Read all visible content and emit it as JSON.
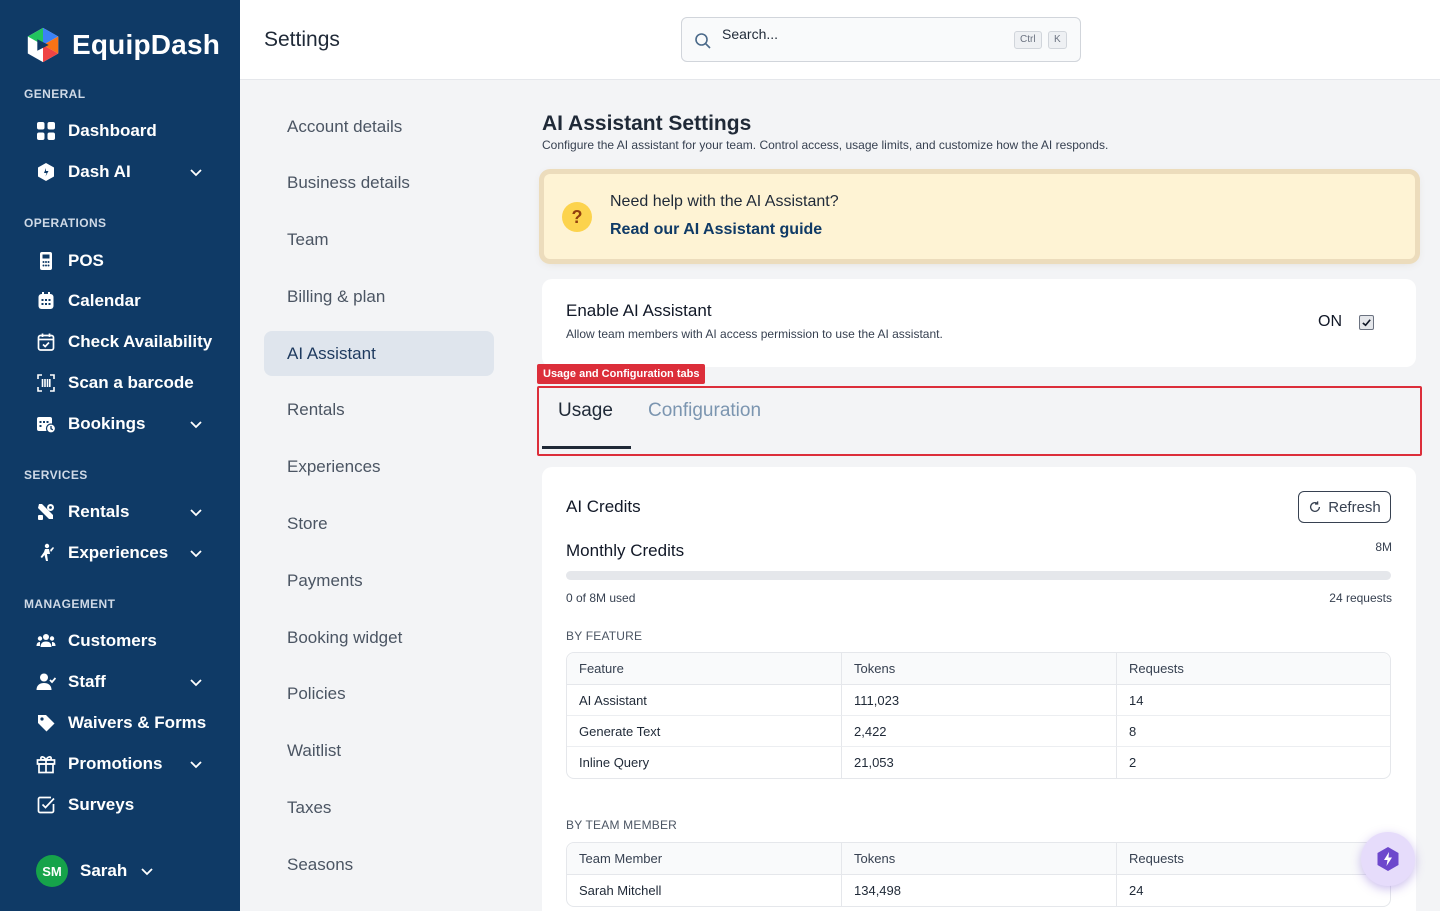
{
  "app": {
    "name": "EquipDash",
    "colors": {
      "sidebar": "#0f3a66",
      "accent": "#0f3a66",
      "annotation": "#dc2e3a",
      "help_bg": "#fef3d4"
    }
  },
  "sidebar": {
    "sections": {
      "general": "GENERAL",
      "operations": "OPERATIONS",
      "services": "SERVICES",
      "management": "MANAGEMENT"
    },
    "items": [
      {
        "label": "Dashboard",
        "icon": "grid-icon"
      },
      {
        "label": "Dash AI",
        "icon": "hexagon-icon",
        "expandable": true
      },
      {
        "label": "POS",
        "icon": "pos-terminal-icon"
      },
      {
        "label": "Calendar",
        "icon": "calendar-icon"
      },
      {
        "label": "Check Availability",
        "icon": "calendar-check-icon"
      },
      {
        "label": "Scan a barcode",
        "icon": "barcode-scan-icon"
      },
      {
        "label": "Bookings",
        "icon": "bookings-icon",
        "expandable": true
      },
      {
        "label": "Rentals",
        "icon": "tools-icon",
        "expandable": true
      },
      {
        "label": "Experiences",
        "icon": "climber-icon",
        "expandable": true
      },
      {
        "label": "Customers",
        "icon": "users-icon"
      },
      {
        "label": "Staff",
        "icon": "staff-icon",
        "expandable": true
      },
      {
        "label": "Waivers & Forms",
        "icon": "tag-icon"
      },
      {
        "label": "Promotions",
        "icon": "gift-icon",
        "expandable": true
      },
      {
        "label": "Surveys",
        "icon": "checkbox-square-icon"
      }
    ],
    "user": {
      "initials": "SM",
      "name": "Sarah"
    }
  },
  "header": {
    "title": "Settings",
    "search": {
      "placeholder": "Search...",
      "kbd_ctrl": "Ctrl",
      "kbd_key": "K"
    }
  },
  "settings_nav": {
    "items": [
      "Account details",
      "Business details",
      "Team",
      "Billing & plan",
      "AI Assistant",
      "Rentals",
      "Experiences",
      "Store",
      "Payments",
      "Booking widget",
      "Policies",
      "Waitlist",
      "Taxes",
      "Seasons"
    ],
    "active": "AI Assistant"
  },
  "page": {
    "title": "AI Assistant Settings",
    "subtitle": "Configure the AI assistant for your team. Control access, usage limits, and customize how the AI responds.",
    "help": {
      "question": "Need help with the AI Assistant?",
      "link": "Read our AI Assistant guide"
    },
    "enable": {
      "title": "Enable AI Assistant",
      "subtitle": "Allow team members with AI access permission to use the AI assistant.",
      "state": "ON",
      "checked": true
    },
    "annotation": "Usage and Configuration tabs",
    "tabs": [
      {
        "label": "Usage",
        "active": true
      },
      {
        "label": "Configuration",
        "active": false
      }
    ],
    "credits": {
      "title": "AI Credits",
      "refresh": "Refresh",
      "monthly_label": "Monthly Credits",
      "limit": "8M",
      "used_text": "0 of 8M used",
      "used_fraction": 0,
      "requests_text": "24 requests"
    },
    "by_feature": {
      "label": "BY FEATURE",
      "columns": [
        "Feature",
        "Tokens",
        "Requests"
      ],
      "rows": [
        [
          "AI Assistant",
          "111,023",
          "14"
        ],
        [
          "Generate Text",
          "2,422",
          "8"
        ],
        [
          "Inline Query",
          "21,053",
          "2"
        ]
      ]
    },
    "by_team_member": {
      "label": "BY TEAM MEMBER",
      "columns": [
        "Team Member",
        "Tokens",
        "Requests"
      ],
      "rows": [
        [
          "Sarah Mitchell",
          "134,498",
          "24"
        ]
      ]
    }
  }
}
